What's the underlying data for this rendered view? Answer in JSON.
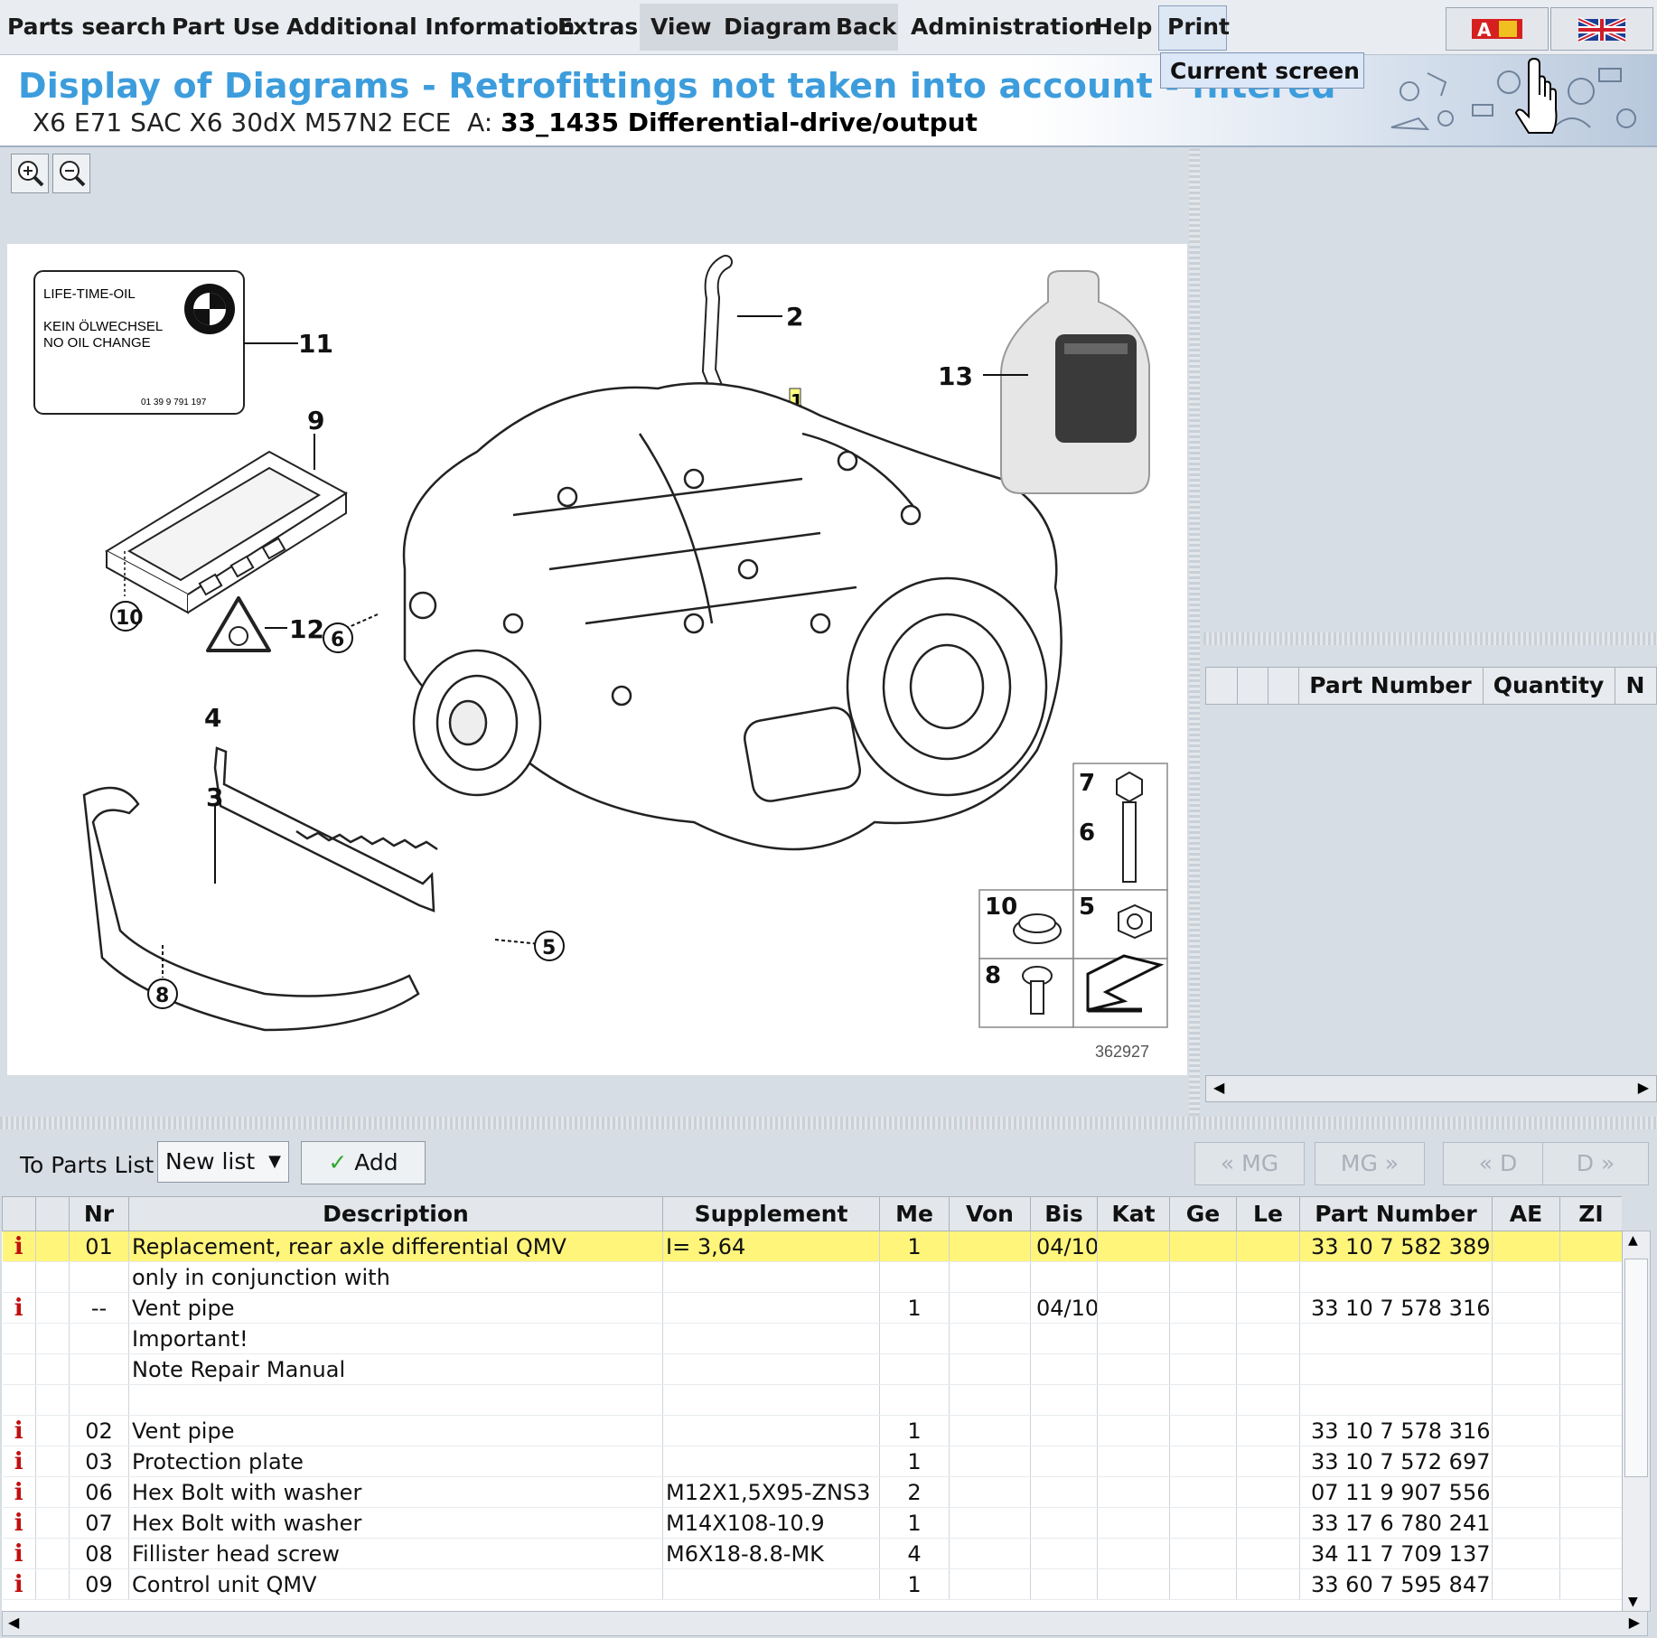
{
  "menu": {
    "items": [
      "Parts search",
      "Part Use",
      "Additional Information",
      "Extras",
      "View",
      "Diagram",
      "Back",
      "Administration",
      "Help",
      "Print"
    ],
    "print_dropdown": "Current screen"
  },
  "header": {
    "title": "Display of Diagrams - Retrofittings not taken into account - filtered",
    "vehicle": "X6 E71 SAC X6 30dX M57N2 ECE",
    "assembly_prefix": "A:",
    "assembly": "33_1435 Differential-drive/output"
  },
  "diagram": {
    "image_number": "362927",
    "label_lines": [
      "LIFE-TIME-OIL",
      "KEIN ÖLWECHSEL",
      "NO OIL CHANGE",
      "01 39 9 791 197"
    ],
    "callouts": [
      "1",
      "2",
      "3",
      "4",
      "5",
      "6",
      "7",
      "8",
      "9",
      "10",
      "11",
      "12",
      "13"
    ]
  },
  "right_panel": {
    "columns": [
      "",
      "",
      "",
      "Part Number",
      "Quantity",
      "N"
    ]
  },
  "toolbar": {
    "to_parts_list": "To Parts List",
    "list_select": "New list",
    "add_label": "Add",
    "nav_buttons": [
      "« MG",
      "MG »",
      "« D",
      "D »"
    ]
  },
  "table": {
    "columns": [
      "",
      "",
      "Nr",
      "Description",
      "Supplement",
      "Me",
      "Von",
      "Bis",
      "Kat",
      "Ge",
      "Le",
      "Part Number",
      "AE",
      "ZI"
    ],
    "rows": [
      {
        "info": "i",
        "nr": "01",
        "desc": "Replacement, rear axle differential QMV",
        "supp": "I= 3,64",
        "me": "1",
        "von": "",
        "bis": "04/10",
        "pn": "33 10 7 582 389",
        "selected": true
      },
      {
        "info": "",
        "nr": "",
        "desc": "only in conjunction with",
        "supp": "",
        "me": "",
        "von": "",
        "bis": "",
        "pn": ""
      },
      {
        "info": "i",
        "nr": "--",
        "desc": "Vent pipe",
        "supp": "",
        "me": "1",
        "von": "",
        "bis": "04/10",
        "pn": "33 10 7 578 316"
      },
      {
        "info": "",
        "nr": "",
        "desc": "Important!",
        "supp": "",
        "me": "",
        "von": "",
        "bis": "",
        "pn": ""
      },
      {
        "info": "",
        "nr": "",
        "desc": "Note Repair Manual",
        "supp": "",
        "me": "",
        "von": "",
        "bis": "",
        "pn": ""
      },
      {
        "info": "",
        "nr": "",
        "desc": "",
        "supp": "",
        "me": "",
        "von": "",
        "bis": "",
        "pn": ""
      },
      {
        "info": "i",
        "nr": "02",
        "desc": "Vent pipe",
        "supp": "",
        "me": "1",
        "von": "",
        "bis": "",
        "pn": "33 10 7 578 316"
      },
      {
        "info": "i",
        "nr": "03",
        "desc": "Protection plate",
        "supp": "",
        "me": "1",
        "von": "",
        "bis": "",
        "pn": "33 10 7 572 697"
      },
      {
        "info": "i",
        "nr": "06",
        "desc": "Hex Bolt with washer",
        "supp": "M12X1,5X95-ZNS3",
        "me": "2",
        "von": "",
        "bis": "",
        "pn": "07 11 9 907 556"
      },
      {
        "info": "i",
        "nr": "07",
        "desc": "Hex Bolt with washer",
        "supp": "M14X108-10.9",
        "me": "1",
        "von": "",
        "bis": "",
        "pn": "33 17 6 780 241"
      },
      {
        "info": "i",
        "nr": "08",
        "desc": "Fillister head screw",
        "supp": "M6X18-8.8-MK",
        "me": "4",
        "von": "",
        "bis": "",
        "pn": "34 11 7 709 137"
      },
      {
        "info": "i",
        "nr": "09",
        "desc": "Control unit QMV",
        "supp": "",
        "me": "1",
        "von": "",
        "bis": "",
        "pn": "33 60 7 595 847"
      }
    ]
  },
  "colors": {
    "title": "#3d9ddc",
    "selected_row": "#fff57a",
    "info_icon": "#c01010",
    "add_check": "#2da82d"
  }
}
